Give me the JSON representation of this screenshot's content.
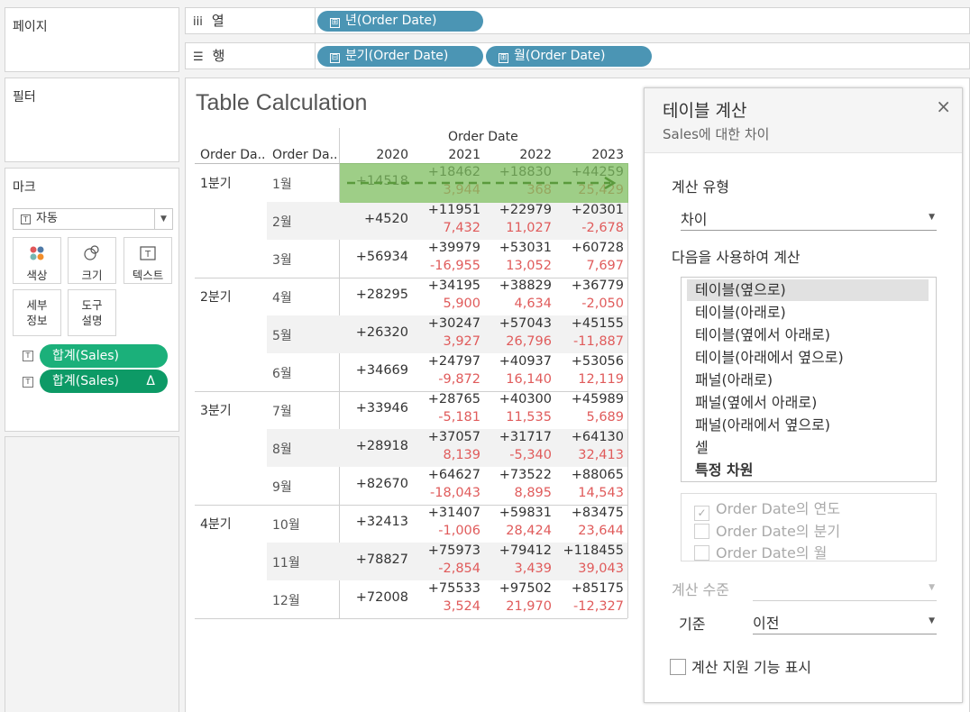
{
  "left": {
    "pages_title": "페이지",
    "filters_title": "필터",
    "marks": {
      "title": "마크",
      "mark_type": "자동",
      "buttons": {
        "color": "색상",
        "size": "크기",
        "text": "텍스트",
        "detail": "세부\n정보",
        "tooltip": "도구\n설명"
      },
      "fields": [
        {
          "label": "합계(Sales)",
          "delta": ""
        },
        {
          "label": "합계(Sales)",
          "delta": "Δ"
        }
      ],
      "colors": {
        "pill1": "#1bb07a",
        "pill2": "#0d9a66"
      }
    }
  },
  "shelves": {
    "columns_label": "열",
    "rows_label": "행",
    "column_pills": [
      "년(Order Date)"
    ],
    "row_pills": [
      "분기(Order Date)",
      "월(Order Date)"
    ],
    "column_pill_icons": [
      "⊞"
    ],
    "row_pill_icons": [
      "⊟",
      "⊞"
    ]
  },
  "viz": {
    "title": "Table Calculation",
    "row_header_1": "Order Da..",
    "row_header_2": "Order Da..",
    "column_field": "Order Date",
    "years": [
      "2020",
      "2021",
      "2022",
      "2023"
    ],
    "quarters": [
      "1분기",
      "2분기",
      "3분기",
      "4분기"
    ],
    "rows": [
      {
        "month": "1월",
        "sales": [
          "+14518",
          "+18462",
          "+18830",
          "+44259"
        ],
        "diff": [
          "",
          "3,944",
          "368",
          "25,429"
        ]
      },
      {
        "month": "2월",
        "sales": [
          "+4520",
          "+11951",
          "+22979",
          "+20301"
        ],
        "diff": [
          "",
          "7,432",
          "11,027",
          "-2,678"
        ]
      },
      {
        "month": "3월",
        "sales": [
          "+56934",
          "+39979",
          "+53031",
          "+60728"
        ],
        "diff": [
          "",
          "-16,955",
          "13,052",
          "7,697"
        ]
      },
      {
        "month": "4월",
        "sales": [
          "+28295",
          "+34195",
          "+38829",
          "+36779"
        ],
        "diff": [
          "",
          "5,900",
          "4,634",
          "-2,050"
        ]
      },
      {
        "month": "5월",
        "sales": [
          "+26320",
          "+30247",
          "+57043",
          "+45155"
        ],
        "diff": [
          "",
          "3,927",
          "26,796",
          "-11,887"
        ]
      },
      {
        "month": "6월",
        "sales": [
          "+34669",
          "+24797",
          "+40937",
          "+53056"
        ],
        "diff": [
          "",
          "-9,872",
          "16,140",
          "12,119"
        ]
      },
      {
        "month": "7월",
        "sales": [
          "+33946",
          "+28765",
          "+40300",
          "+45989"
        ],
        "diff": [
          "",
          "-5,181",
          "11,535",
          "5,689"
        ]
      },
      {
        "month": "8월",
        "sales": [
          "+28918",
          "+37057",
          "+31717",
          "+64130"
        ],
        "diff": [
          "",
          "8,139",
          "-5,340",
          "32,413"
        ]
      },
      {
        "month": "9월",
        "sales": [
          "+82670",
          "+64627",
          "+73522",
          "+88065"
        ],
        "diff": [
          "",
          "-18,043",
          "8,895",
          "14,543"
        ]
      },
      {
        "month": "10월",
        "sales": [
          "+32413",
          "+31407",
          "+59831",
          "+83475"
        ],
        "diff": [
          "",
          "-1,006",
          "28,424",
          "23,644"
        ]
      },
      {
        "month": "11월",
        "sales": [
          "+78827",
          "+75973",
          "+79412",
          "+118455"
        ],
        "diff": [
          "",
          "-2,854",
          "3,439",
          "39,043"
        ]
      },
      {
        "month": "12월",
        "sales": [
          "+72008",
          "+75533",
          "+97502",
          "+85175"
        ],
        "diff": [
          "",
          "3,524",
          "21,970",
          "-12,327"
        ]
      }
    ],
    "colors": {
      "diff": "#e05b5b",
      "highlight": "#8cc86f",
      "band": "#f2f2f2"
    }
  },
  "panel": {
    "title": "테이블 계산",
    "subtitle": "Sales에 대한 차이",
    "close": "×",
    "calc_type_label": "계산 유형",
    "calc_type_value": "차이",
    "compute_using_label": "다음을 사용하여 계산",
    "compute_options": [
      "테이블(옆으로)",
      "테이블(아래로)",
      "테이블(옆에서 아래로)",
      "테이블(아래에서 옆으로)",
      "패널(아래로)",
      "패널(옆에서 아래로)",
      "패널(아래에서 옆으로)",
      "셀",
      "특정 차원"
    ],
    "selected_option": "테이블(옆으로)",
    "dimensions": [
      {
        "label": "Order Date의 연도",
        "checked": true
      },
      {
        "label": "Order Date의 분기",
        "checked": false
      },
      {
        "label": "Order Date의 월",
        "checked": false
      }
    ],
    "level_label": "계산 수준",
    "level_value": "",
    "relative_label": "기준",
    "relative_value": "이전",
    "show_assist_label": "계산 지원 기능 표시"
  }
}
